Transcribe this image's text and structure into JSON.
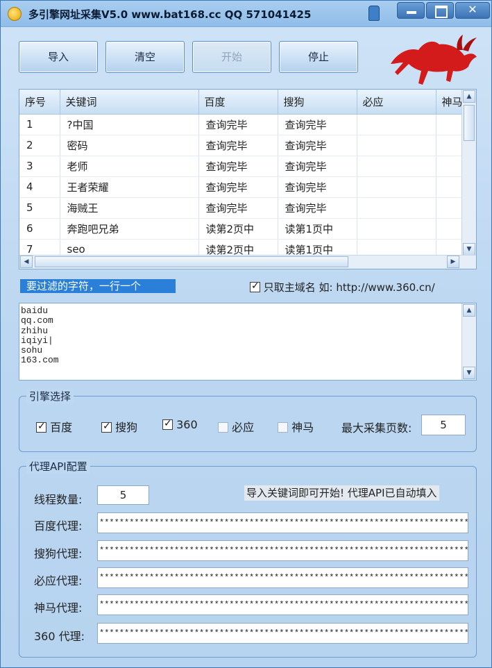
{
  "window": {
    "title": "多引擎网址采集V5.0   www.bat168.cc   QQ 571041425",
    "controls": {
      "minimize": "",
      "maximize": "",
      "close": "✕"
    }
  },
  "toolbar": {
    "import_label": "导入",
    "clear_label": "清空",
    "start_label": "开始",
    "stop_label": "停止"
  },
  "table": {
    "columns": [
      "序号",
      "关键词",
      "百度",
      "搜狗",
      "必应",
      "神马"
    ],
    "rows": [
      [
        "1",
        "?中国",
        "查询完毕",
        "查询完毕",
        "",
        ""
      ],
      [
        "2",
        "密码",
        "查询完毕",
        "查询完毕",
        "",
        ""
      ],
      [
        "3",
        "老师",
        "查询完毕",
        "查询完毕",
        "",
        ""
      ],
      [
        "4",
        "王者荣耀",
        "查询完毕",
        "查询完毕",
        "",
        ""
      ],
      [
        "5",
        "海贼王",
        "查询完毕",
        "查询完毕",
        "",
        ""
      ],
      [
        "6",
        "奔跑吧兄弟",
        "读第2页中",
        "读第1页中",
        "",
        ""
      ],
      [
        "7",
        "seo",
        "读第2页中",
        "读第1页中",
        "",
        ""
      ]
    ]
  },
  "filter": {
    "label": "要过滤的字符，一行一个",
    "main_domain_label": "只取主域名 如: http://www.360.cn/",
    "main_domain_checked": true,
    "text": "baidu\nqq.com\nzhihu\niqiyi|\nsohu\n163.com"
  },
  "engines": {
    "title": "引擎选择",
    "items": [
      {
        "label": "百度",
        "checked": true
      },
      {
        "label": "搜狗",
        "checked": true
      },
      {
        "label": "360",
        "checked": true
      },
      {
        "label": "必应",
        "checked": false
      },
      {
        "label": "神马",
        "checked": false
      }
    ],
    "max_pages_label": "最大采集页数:",
    "max_pages_value": "5"
  },
  "proxy": {
    "title": "代理API配置",
    "threads_label": "线程数量:",
    "threads_value": "5",
    "hint": "导入关键词即可开始! 代理API已自动填入",
    "baidu_label": "百度代理:",
    "sogou_label": "搜狗代理:",
    "bing_label": "必应代理:",
    "shenma_label": "神马代理:",
    "s360_label": "360 代理:",
    "masked_value": "*********************************************************************************"
  },
  "colors": {
    "window_bg": "#bcd7f1",
    "title_bar": "#8fbde9",
    "filter_label_bg": "#2a7fd8",
    "bull": "#d41b1b"
  },
  "icons": [
    "app-logo-icon",
    "shirt-skin-icon",
    "bull-logo-icon",
    "scroll-up-icon",
    "scroll-down-icon",
    "scroll-left-icon",
    "scroll-right-icon"
  ]
}
